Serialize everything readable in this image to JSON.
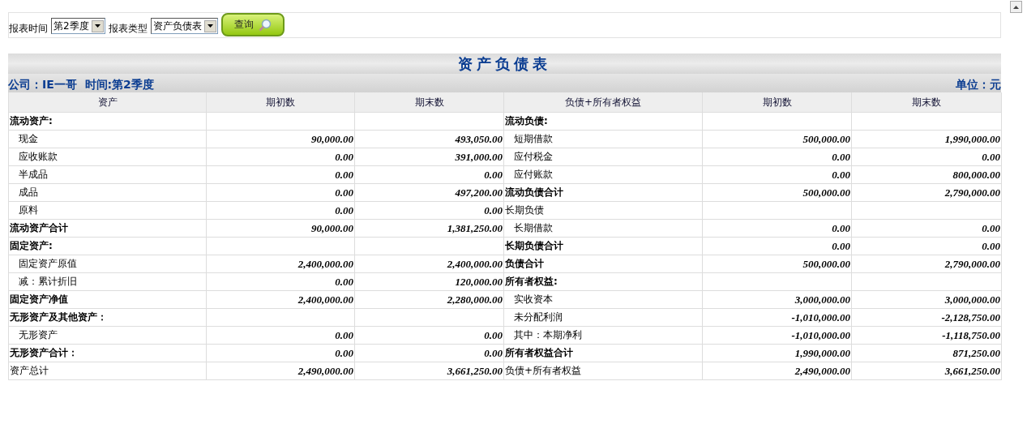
{
  "filters": [
    {
      "label": "报表时间",
      "value": "第2季度"
    },
    {
      "label": "报表类型",
      "value": "资产负债表"
    }
  ],
  "query_button": "查询",
  "report": {
    "title": "资产负债表",
    "company": "公司：IE一哥  时间:第2季度",
    "unit": "单位：元",
    "columns": [
      "资产",
      "期初数",
      "期末数",
      "负债+所有者权益",
      "期初数",
      "期末数"
    ],
    "rows": [
      {
        "left": {
          "kind": "section",
          "label": "流动资产:"
        },
        "right": {
          "kind": "section",
          "label": "流动负债:"
        }
      },
      {
        "left": {
          "kind": "item",
          "label": "现金",
          "begin": "90,000.00",
          "end": "493,050.00"
        },
        "right": {
          "kind": "item",
          "label": "短期借款",
          "begin": "500,000.00",
          "end": "1,990,000.00"
        }
      },
      {
        "left": {
          "kind": "item",
          "label": "应收账款",
          "begin": "0.00",
          "end": "391,000.00"
        },
        "right": {
          "kind": "item",
          "label": "应付税金",
          "begin": "0.00",
          "end": "0.00"
        }
      },
      {
        "left": {
          "kind": "item",
          "label": "半成品",
          "begin": "0.00",
          "end": "0.00"
        },
        "right": {
          "kind": "item",
          "label": "应付账款",
          "begin": "0.00",
          "end": "800,000.00"
        }
      },
      {
        "left": {
          "kind": "item",
          "label": "成品",
          "begin": "0.00",
          "end": "497,200.00"
        },
        "right": {
          "kind": "total",
          "label": "流动负债合计",
          "begin": "500,000.00",
          "end": "2,790,000.00"
        }
      },
      {
        "left": {
          "kind": "item",
          "label": "原料",
          "begin": "0.00",
          "end": "0.00"
        },
        "right": {
          "kind": "plain",
          "label": "长期负债"
        }
      },
      {
        "left": {
          "kind": "total",
          "label": "流动资产合计",
          "begin": "90,000.00",
          "end": "1,381,250.00"
        },
        "right": {
          "kind": "item",
          "label": "长期借款",
          "begin": "0.00",
          "end": "0.00"
        }
      },
      {
        "left": {
          "kind": "section",
          "label": "固定资产:"
        },
        "right": {
          "kind": "total",
          "label": "长期负债合计",
          "begin": "0.00",
          "end": "0.00"
        }
      },
      {
        "left": {
          "kind": "item",
          "label": "固定资产原值",
          "begin": "2,400,000.00",
          "end": "2,400,000.00"
        },
        "right": {
          "kind": "total",
          "label": "负债合计",
          "begin": "500,000.00",
          "end": "2,790,000.00"
        }
      },
      {
        "left": {
          "kind": "item",
          "label": "减：累计折旧",
          "begin": "0.00",
          "end": "120,000.00"
        },
        "right": {
          "kind": "section",
          "label": "所有者权益:"
        }
      },
      {
        "left": {
          "kind": "total",
          "label": "固定资产净值",
          "begin": "2,400,000.00",
          "end": "2,280,000.00"
        },
        "right": {
          "kind": "item",
          "label": "实收资本",
          "begin": "3,000,000.00",
          "end": "3,000,000.00"
        }
      },
      {
        "left": {
          "kind": "section",
          "label": "无形资产及其他资产："
        },
        "right": {
          "kind": "item",
          "label": "未分配利润",
          "begin": "-1,010,000.00",
          "end": "-2,128,750.00"
        }
      },
      {
        "left": {
          "kind": "item",
          "label": "无形资产",
          "begin": "0.00",
          "end": "0.00"
        },
        "right": {
          "kind": "item",
          "label": "其中：本期净利",
          "begin": "-1,010,000.00",
          "end": "-1,118,750.00"
        }
      },
      {
        "left": {
          "kind": "total",
          "label": "无形资产合计：",
          "begin": "0.00",
          "end": "0.00"
        },
        "right": {
          "kind": "total",
          "label": "所有者权益合计",
          "begin": "1,990,000.00",
          "end": "871,250.00"
        }
      },
      {
        "left": {
          "kind": "plain",
          "label": "资产总计",
          "begin": "2,490,000.00",
          "end": "3,661,250.00"
        },
        "right": {
          "kind": "plain",
          "label": "负债+所有者权益",
          "begin": "2,490,000.00",
          "end": "3,661,250.00"
        }
      }
    ]
  }
}
